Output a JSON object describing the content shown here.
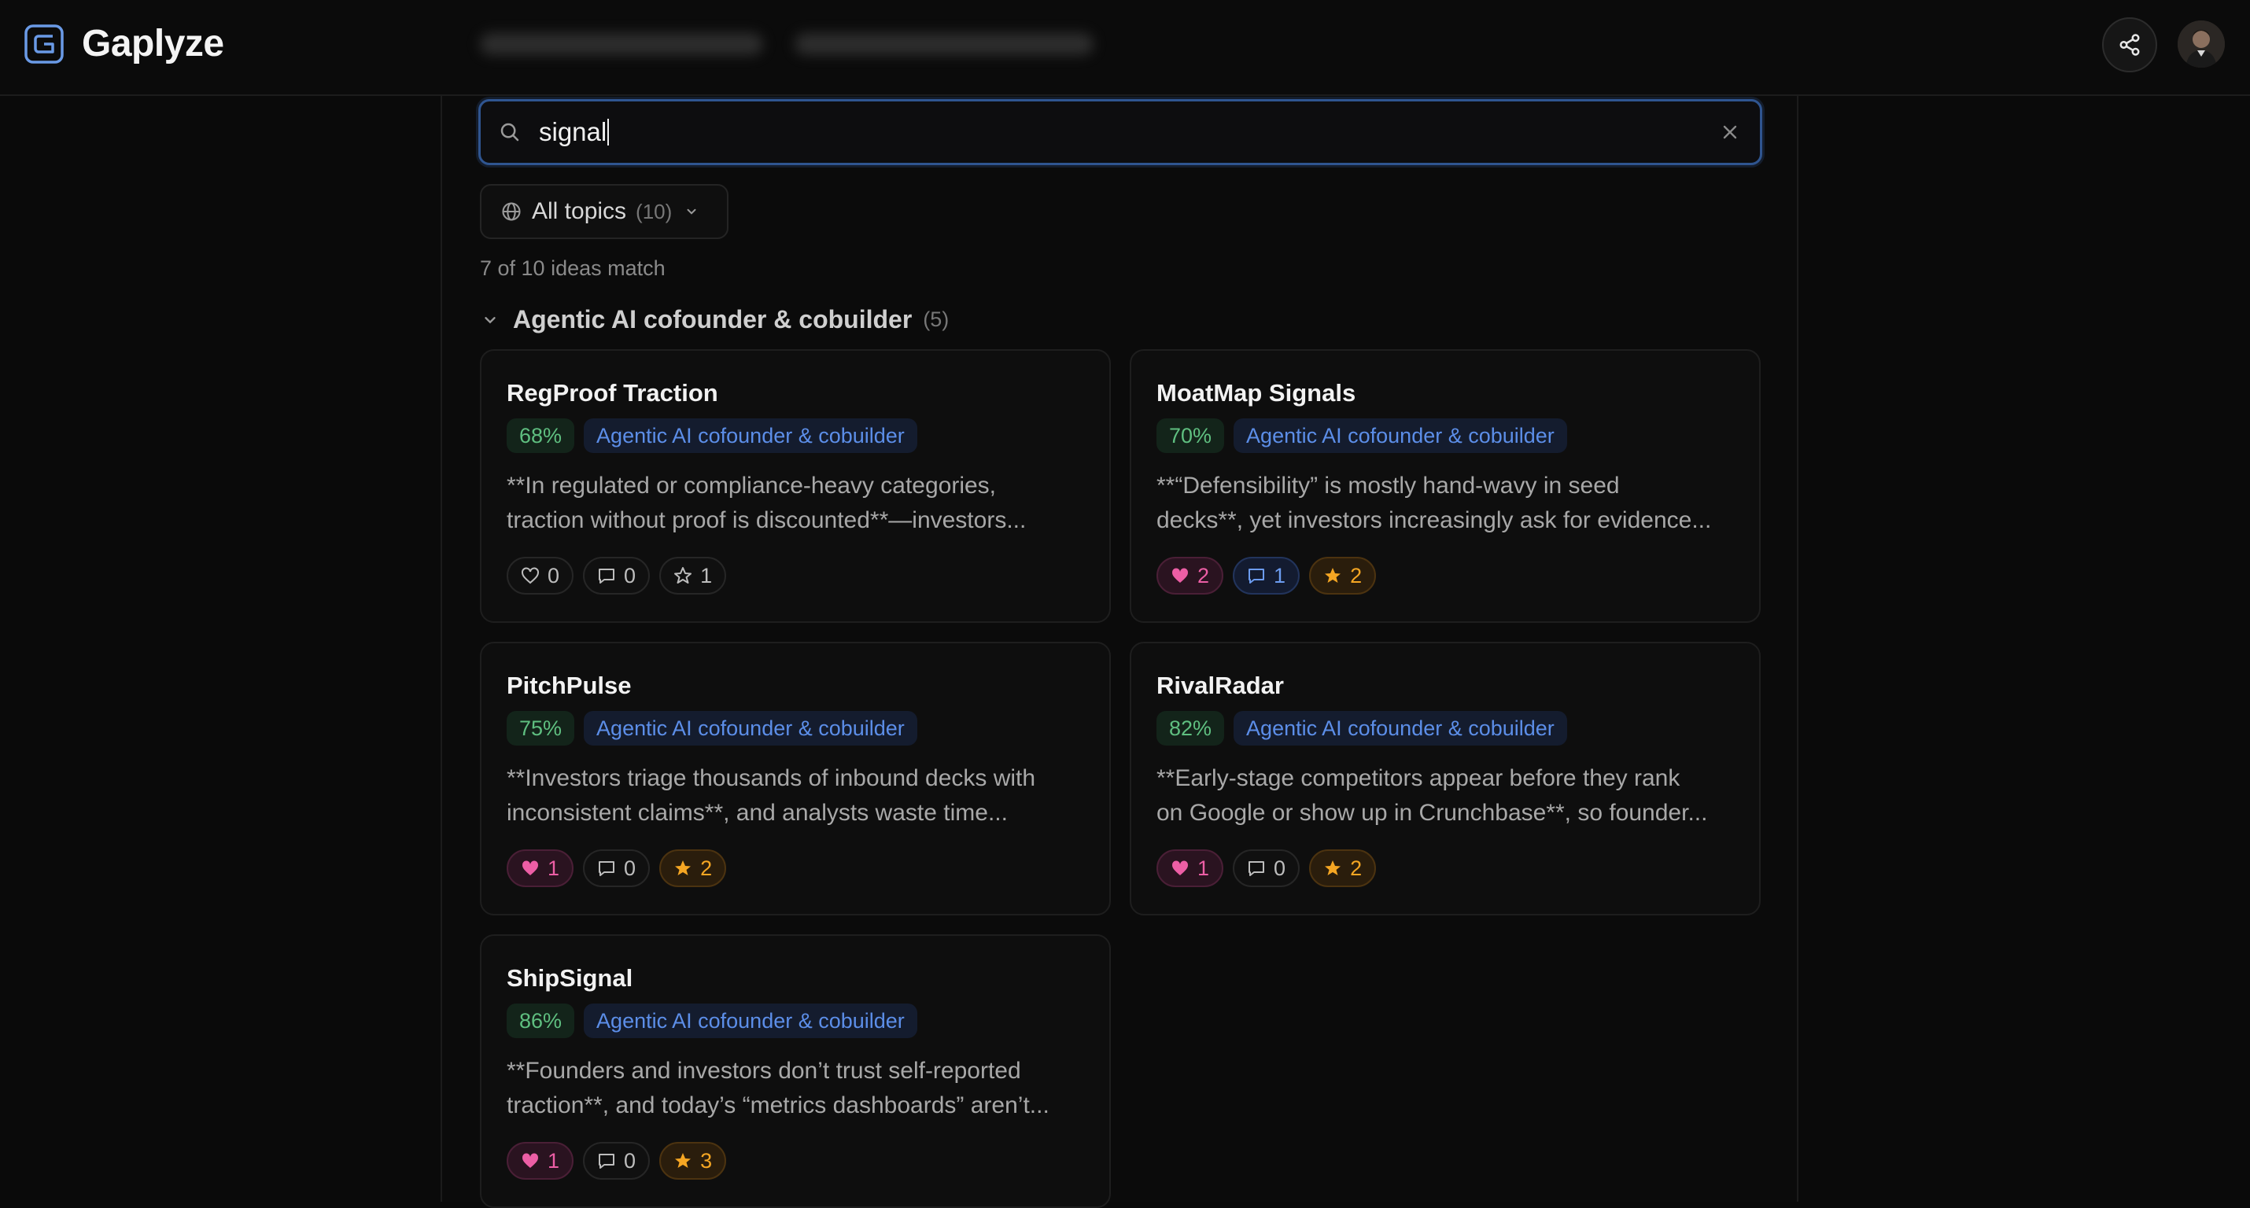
{
  "app": {
    "brand": "Gaplyze"
  },
  "colors": {
    "accent": "#2f5590",
    "score": "#5fbf80",
    "topic": "#5c8ee8",
    "heart": "#ec5ea5",
    "star": "#f5a623"
  },
  "search": {
    "value": "signal",
    "clear_icon": "close-icon"
  },
  "filter": {
    "label": "All topics",
    "count": "(10)"
  },
  "results": {
    "match_text": "7 of 10 ideas match"
  },
  "group": {
    "title": "Agentic AI cofounder & cobuilder",
    "count": "(5)"
  },
  "cards": [
    {
      "title": "RegProof Traction",
      "score": "68%",
      "topic": "Agentic AI cofounder & cobuilder",
      "line1": "**In regulated or compliance-heavy categories,",
      "line2": "traction without proof is discounted**—investors...",
      "likes": "0",
      "comments": "0",
      "stars": "1"
    },
    {
      "title": "MoatMap Signals",
      "score": "70%",
      "topic": "Agentic AI cofounder & cobuilder",
      "line1": "**“Defensibility” is mostly hand-wavy in seed",
      "line2": "decks**, yet investors increasingly ask for evidence...",
      "likes": "2",
      "comments": "1",
      "stars": "2"
    },
    {
      "title": "PitchPulse",
      "score": "75%",
      "topic": "Agentic AI cofounder & cobuilder",
      "line1": "**Investors triage thousands of inbound decks with",
      "line2": "inconsistent claims**, and analysts waste time...",
      "likes": "1",
      "comments": "0",
      "stars": "2"
    },
    {
      "title": "RivalRadar",
      "score": "82%",
      "topic": "Agentic AI cofounder & cobuilder",
      "line1": "**Early-stage competitors appear before they rank",
      "line2": "on Google or show up in Crunchbase**, so founder...",
      "likes": "1",
      "comments": "0",
      "stars": "2"
    },
    {
      "title": "ShipSignal",
      "score": "86%",
      "topic": "Agentic AI cofounder & cobuilder",
      "line1": "**Founders and investors don’t trust self-reported",
      "line2": "traction**, and today’s “metrics dashboards” aren’t...",
      "likes": "1",
      "comments": "0",
      "stars": "3"
    }
  ]
}
